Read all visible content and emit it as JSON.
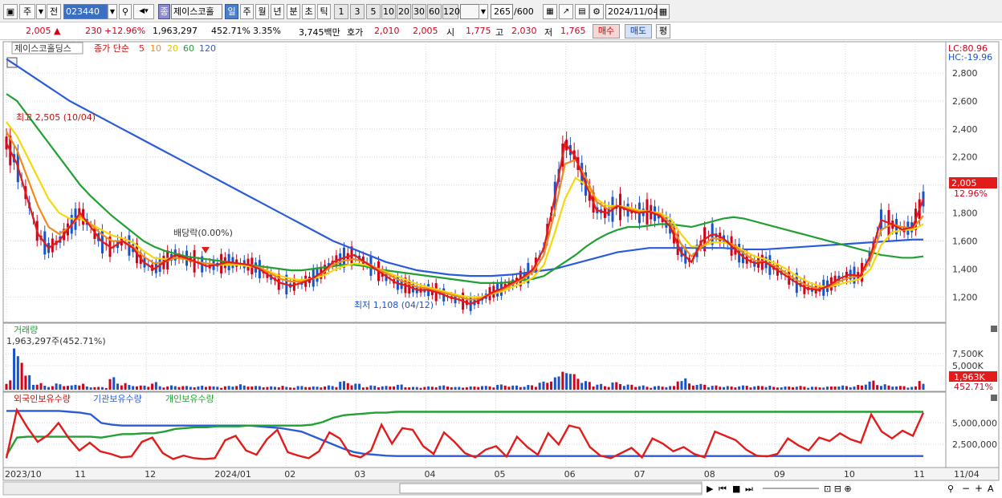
{
  "toolbar": {
    "period_mode": "주",
    "prev_label": "전",
    "code": "023440",
    "stock_badge": "종",
    "stock_name": "제이스코홀",
    "tf_day": "일",
    "tf_week": "주",
    "tf_month": "월",
    "tf_year": "년",
    "tf_minute": "분",
    "tf_second": "초",
    "tf_tick": "틱",
    "n1": "1",
    "n3": "3",
    "n5": "5",
    "n10": "10",
    "n20": "20",
    "n30": "30",
    "n60": "60",
    "n120": "120",
    "count": "265",
    "count_max": "/600",
    "date": "2024/11/04"
  },
  "quote": {
    "price": "2,005",
    "change": "230",
    "change_pct": "+12.96%",
    "volume": "1,963,297",
    "vol_ratio": "452.71%",
    "turnover": "3.35%",
    "amount": "3,745백만",
    "ask_label": "호가",
    "ask1": "2,010",
    "bid1": "2,005",
    "open_label": "시",
    "open": "1,775",
    "high_label": "고",
    "high": "2,030",
    "low_label": "저",
    "low": "1,765",
    "buy_label": "매수",
    "sell_label": "매도",
    "eval_label": "평"
  },
  "chart_data": {
    "type": "line",
    "title": "제이스코홀딩스",
    "indicator_label": "종가 단순",
    "ma_periods": [
      "5",
      "10",
      "20",
      "60",
      "120"
    ],
    "ma_colors": [
      "#e21b1b",
      "#f08a1a",
      "#f5d80c",
      "#21a033",
      "#2b5bd7"
    ],
    "price_axis": {
      "ticks": [
        "2,800",
        "2,600",
        "2,400",
        "2,200",
        "2,000",
        "1,800",
        "1,600",
        "1,400",
        "1,200"
      ],
      "values": [
        2800,
        2600,
        2400,
        2200,
        2000,
        1800,
        1600,
        1400,
        1200
      ],
      "ylim": [
        1030,
        2920
      ]
    },
    "lc_label": "LC:80.96",
    "hc_label": "HC:-19.96",
    "current_price": "2,005",
    "current_pct": "12.96%",
    "high_annotation": "최고 2,505 (10/04)",
    "low_annotation": "최저 1,108 (04/12)",
    "dividend_annotation": "배당락(0.00%)",
    "x_labels": [
      "2023/10",
      "11",
      "12",
      "2024/01",
      "02",
      "03",
      "04",
      "05",
      "06",
      "07",
      "08",
      "09",
      "10",
      "11"
    ],
    "x_label_right": "11/04",
    "ma5": [
      2300,
      2150,
      1900,
      1650,
      1550,
      1600,
      1700,
      1800,
      1700,
      1600,
      1550,
      1600,
      1550,
      1450,
      1400,
      1450,
      1500,
      1480,
      1450,
      1420,
      1430,
      1450,
      1440,
      1430,
      1400,
      1350,
      1300,
      1280,
      1300,
      1330,
      1380,
      1450,
      1480,
      1500,
      1450,
      1400,
      1350,
      1300,
      1280,
      1250,
      1250,
      1230,
      1200,
      1180,
      1150,
      1180,
      1230,
      1260,
      1300,
      1340,
      1400,
      1550,
      1900,
      2300,
      2200,
      2000,
      1820,
      1800,
      1850,
      1820,
      1800,
      1810,
      1780,
      1700,
      1520,
      1450,
      1600,
      1650,
      1620,
      1550,
      1480,
      1440,
      1450,
      1400,
      1350,
      1300,
      1260,
      1250,
      1280,
      1330,
      1360,
      1350,
      1500,
      1750,
      1720,
      1680,
      1700,
      1900
    ],
    "ma10": [
      2380,
      2250,
      2050,
      1850,
      1700,
      1650,
      1700,
      1780,
      1720,
      1650,
      1600,
      1600,
      1560,
      1490,
      1440,
      1450,
      1480,
      1470,
      1450,
      1440,
      1430,
      1440,
      1440,
      1430,
      1410,
      1370,
      1330,
      1310,
      1310,
      1330,
      1370,
      1430,
      1460,
      1470,
      1450,
      1410,
      1370,
      1330,
      1300,
      1270,
      1260,
      1240,
      1220,
      1200,
      1180,
      1190,
      1220,
      1250,
      1290,
      1330,
      1380,
      1500,
      1800,
      2150,
      2180,
      2050,
      1880,
      1830,
      1850,
      1830,
      1810,
      1810,
      1790,
      1730,
      1580,
      1490,
      1560,
      1620,
      1610,
      1570,
      1510,
      1460,
      1450,
      1420,
      1370,
      1320,
      1280,
      1260,
      1270,
      1310,
      1340,
      1350,
      1460,
      1680,
      1720,
      1700,
      1690,
      1780
    ],
    "ma20": [
      2450,
      2350,
      2200,
      2050,
      1900,
      1800,
      1760,
      1760,
      1720,
      1680,
      1640,
      1620,
      1590,
      1530,
      1480,
      1470,
      1480,
      1470,
      1450,
      1440,
      1430,
      1430,
      1430,
      1420,
      1410,
      1380,
      1350,
      1330,
      1320,
      1330,
      1350,
      1390,
      1420,
      1440,
      1430,
      1410,
      1380,
      1350,
      1320,
      1290,
      1270,
      1250,
      1230,
      1210,
      1200,
      1200,
      1220,
      1240,
      1270,
      1300,
      1340,
      1430,
      1650,
      1900,
      2050,
      2000,
      1900,
      1850,
      1850,
      1840,
      1820,
      1810,
      1800,
      1760,
      1650,
      1560,
      1560,
      1590,
      1590,
      1570,
      1530,
      1490,
      1470,
      1440,
      1400,
      1350,
      1310,
      1280,
      1270,
      1290,
      1310,
      1330,
      1400,
      1570,
      1660,
      1680,
      1680,
      1720
    ],
    "ma60": [
      2650,
      2600,
      2500,
      2400,
      2300,
      2200,
      2100,
      2000,
      1920,
      1850,
      1780,
      1720,
      1660,
      1600,
      1560,
      1530,
      1510,
      1490,
      1480,
      1470,
      1460,
      1450,
      1440,
      1430,
      1420,
      1410,
      1400,
      1390,
      1390,
      1400,
      1410,
      1420,
      1430,
      1430,
      1420,
      1400,
      1390,
      1380,
      1370,
      1360,
      1350,
      1340,
      1330,
      1320,
      1310,
      1300,
      1300,
      1300,
      1310,
      1320,
      1330,
      1350,
      1400,
      1450,
      1500,
      1560,
      1610,
      1650,
      1680,
      1700,
      1700,
      1710,
      1720,
      1720,
      1710,
      1700,
      1720,
      1740,
      1760,
      1770,
      1760,
      1740,
      1720,
      1700,
      1680,
      1660,
      1640,
      1620,
      1600,
      1580,
      1560,
      1540,
      1520,
      1500,
      1490,
      1480,
      1480,
      1490
    ],
    "ma120": [
      2900,
      2850,
      2800,
      2750,
      2700,
      2650,
      2600,
      2560,
      2520,
      2480,
      2440,
      2400,
      2360,
      2320,
      2280,
      2240,
      2200,
      2160,
      2120,
      2080,
      2040,
      2000,
      1960,
      1920,
      1880,
      1840,
      1800,
      1760,
      1720,
      1680,
      1640,
      1600,
      1570,
      1540,
      1510,
      1480,
      1450,
      1430,
      1410,
      1390,
      1380,
      1370,
      1360,
      1355,
      1350,
      1350,
      1350,
      1355,
      1360,
      1370,
      1380,
      1390,
      1400,
      1420,
      1440,
      1460,
      1480,
      1500,
      1520,
      1530,
      1540,
      1550,
      1550,
      1550,
      1550,
      1550,
      1550,
      1550,
      1550,
      1545,
      1540,
      1540,
      1540,
      1545,
      1550,
      1555,
      1560,
      1565,
      1570,
      1575,
      1580,
      1585,
      1590,
      1595,
      1600,
      1605,
      1610,
      1610
    ]
  },
  "volume_panel": {
    "title": "거래량",
    "value_label": "1,963,297주(452.71%)",
    "ticks": [
      "7,500K",
      "5,000K"
    ],
    "tick_values": [
      7500,
      5000
    ],
    "ylim": [
      0,
      9000
    ],
    "current": "1,963K",
    "current_pct": "452.71%",
    "values": [
      2200,
      8600,
      3100,
      1400,
      900,
      1300,
      900,
      1300,
      700,
      600,
      2600,
      1500,
      1000,
      900,
      1600,
      800,
      900,
      800,
      700,
      900,
      700,
      800,
      1200,
      900,
      800,
      700,
      900,
      600,
      800,
      700,
      800,
      900,
      1800,
      1300,
      700,
      900,
      800,
      1100,
      700,
      600,
      700,
      900,
      800,
      600,
      700,
      900,
      800,
      1100,
      900,
      800,
      1000,
      1700,
      2800,
      4900,
      3400,
      1800,
      1200,
      900,
      1600,
      1100,
      900,
      700,
      800,
      800,
      2400,
      1400,
      1200,
      900,
      800,
      700,
      900,
      800,
      900,
      600,
      700,
      800,
      700,
      600,
      700,
      900,
      800,
      1000,
      1900,
      1200,
      900,
      800,
      700,
      2100
    ]
  },
  "holdings_panel": {
    "series_names": [
      "외국인보유수량",
      "기관보유수량",
      "개인보유수량"
    ],
    "ticks": [
      "5,000,000",
      "2,500,000"
    ],
    "tick_values": [
      5000000,
      2500000
    ],
    "ylim": [
      0,
      7000000
    ],
    "foreign": [
      900000,
      6500000,
      4500000,
      2800000,
      3600000,
      5000000,
      3200000,
      1800000,
      2700000,
      1700000,
      1400000,
      1000000,
      1100000,
      2800000,
      3300000,
      1500000,
      800000,
      1200000,
      900000,
      800000,
      900000,
      3000000,
      3500000,
      1800000,
      1300000,
      3100000,
      4200000,
      1600000,
      1200000,
      900000,
      1700000,
      3900000,
      3200000,
      1300000,
      1000000,
      1800000,
      4800000,
      2600000,
      4400000,
      4200000,
      2300000,
      1400000,
      3900000,
      2800000,
      1500000,
      1000000,
      1900000,
      2300000,
      1100000,
      3400000,
      2200000,
      1300000,
      3800000,
      2500000,
      4700000,
      4400000,
      2200000,
      1200000,
      900000,
      1500000,
      2100000,
      1000000,
      3200000,
      2600000,
      1700000,
      2200000,
      1400000,
      1000000,
      4000000,
      3500000,
      3000000,
      1900000,
      1200000,
      1100000,
      1400000,
      3200000,
      2400000,
      1800000,
      3300000,
      2900000,
      3800000,
      3100000,
      2700000,
      6000000,
      4000000,
      3200000,
      4100000,
      3500000,
      6200000
    ],
    "institution": [
      6400000,
      6400000,
      6400000,
      6400000,
      6400000,
      6400000,
      6300000,
      6200000,
      6000000,
      5000000,
      4800000,
      4700000,
      4700000,
      4700000,
      4700000,
      4700000,
      4700000,
      4700000,
      4700000,
      4700000,
      4700000,
      4700000,
      4700000,
      4700000,
      4600000,
      4500000,
      4400000,
      4200000,
      4000000,
      3500000,
      3000000,
      2500000,
      2000000,
      1600000,
      1400000,
      1300000,
      1200000,
      1150000,
      1150000,
      1150000,
      1150000,
      1150000,
      1150000,
      1150000,
      1150000,
      1150000,
      1150000,
      1150000,
      1150000,
      1150000,
      1150000,
      1150000,
      1150000,
      1150000,
      1150000,
      1150000,
      1150000,
      1150000,
      1150000,
      1150000,
      1150000,
      1150000,
      1150000,
      1150000,
      1150000,
      1150000,
      1150000,
      1150000,
      1150000,
      1150000,
      1150000,
      1150000,
      1150000,
      1150000,
      1150000,
      1150000,
      1150000,
      1150000,
      1150000,
      1150000,
      1150000,
      1150000,
      1150000,
      1150000,
      1150000,
      1150000,
      1150000,
      1150000
    ],
    "individual": [
      1200000,
      3300000,
      3400000,
      3400000,
      3400000,
      3400000,
      3400000,
      3400000,
      3400000,
      3300000,
      3500000,
      3700000,
      3700000,
      3800000,
      3800000,
      4000000,
      4300000,
      4400000,
      4500000,
      4500000,
      4600000,
      4600000,
      4600000,
      4700000,
      4700000,
      4700000,
      4700000,
      4700000,
      4700000,
      4800000,
      5100000,
      5600000,
      5900000,
      6000000,
      6100000,
      6200000,
      6200000,
      6300000,
      6300000,
      6300000,
      6300000,
      6300000,
      6300000,
      6300000,
      6300000,
      6300000,
      6300000,
      6300000,
      6300000,
      6300000,
      6300000,
      6300000,
      6300000,
      6300000,
      6300000,
      6300000,
      6300000,
      6300000,
      6300000,
      6300000,
      6300000,
      6300000,
      6300000,
      6300000,
      6300000,
      6300000,
      6300000,
      6300000,
      6300000,
      6300000,
      6300000,
      6300000,
      6300000,
      6300000,
      6300000,
      6300000,
      6300000,
      6300000,
      6300000,
      6300000,
      6300000,
      6300000,
      6300000,
      6300000,
      6300000,
      6300000,
      6300000,
      6300000
    ]
  },
  "colors": {
    "up": "#d0021b",
    "down": "#1a53c8",
    "grid": "#d6d6d6",
    "foreign": "#e21b1b",
    "institution": "#2b5bd7",
    "individual": "#21a033"
  }
}
